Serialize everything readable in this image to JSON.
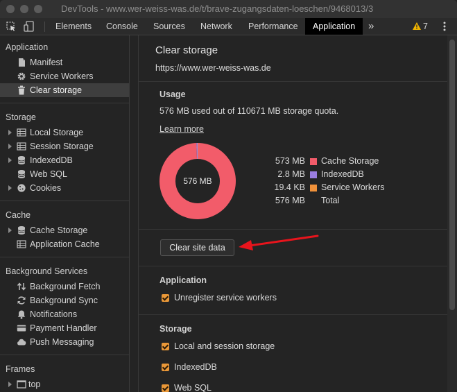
{
  "window": {
    "title": "DevTools - www.wer-weiss-was.de/t/brave-zugangsdaten-loeschen/9468013/3"
  },
  "tabs": [
    "Elements",
    "Console",
    "Sources",
    "Network",
    "Performance",
    "Application"
  ],
  "tabs_overflow": "»",
  "warnings": {
    "count": "7"
  },
  "sidebar": {
    "application": {
      "heading": "Application",
      "items": [
        "Manifest",
        "Service Workers",
        "Clear storage"
      ]
    },
    "storage": {
      "heading": "Storage",
      "items": [
        "Local Storage",
        "Session Storage",
        "IndexedDB",
        "Web SQL",
        "Cookies"
      ]
    },
    "cache": {
      "heading": "Cache",
      "items": [
        "Cache Storage",
        "Application Cache"
      ]
    },
    "background": {
      "heading": "Background Services",
      "items": [
        "Background Fetch",
        "Background Sync",
        "Notifications",
        "Payment Handler",
        "Push Messaging"
      ]
    },
    "frames": {
      "heading": "Frames",
      "items": [
        "top"
      ]
    }
  },
  "main": {
    "title": "Clear storage",
    "origin": "https://www.wer-weiss-was.de",
    "usage": {
      "heading": "Usage",
      "summary": "576 MB used out of 110671 MB storage quota.",
      "learn_more": "Learn more",
      "total_center": "576 MB",
      "legend": [
        {
          "value": "573 MB",
          "name": "Cache Storage",
          "color": "#f25c6a"
        },
        {
          "value": "2.8 MB",
          "name": "IndexedDB",
          "color": "#9a7de0"
        },
        {
          "value": "19.4 KB",
          "name": "Service Workers",
          "color": "#f0913a"
        },
        {
          "value": "576 MB",
          "name": "Total",
          "color": ""
        }
      ]
    },
    "clear_button": "Clear site data",
    "application_section": {
      "heading": "Application",
      "options": [
        "Unregister service workers"
      ]
    },
    "storage_section": {
      "heading": "Storage",
      "options": [
        "Local and session storage",
        "IndexedDB",
        "Web SQL"
      ]
    }
  },
  "chart_data": {
    "type": "pie",
    "categories": [
      "Cache Storage",
      "IndexedDB",
      "Service Workers"
    ],
    "values": [
      573,
      2.8,
      0.0194
    ],
    "units": "MB",
    "center_label": "576 MB"
  },
  "colors": {
    "accent": "#ea9838",
    "arrow": "#e8141c",
    "donut_main": "#f25c6a",
    "donut_secondary": "#9a7de0"
  }
}
